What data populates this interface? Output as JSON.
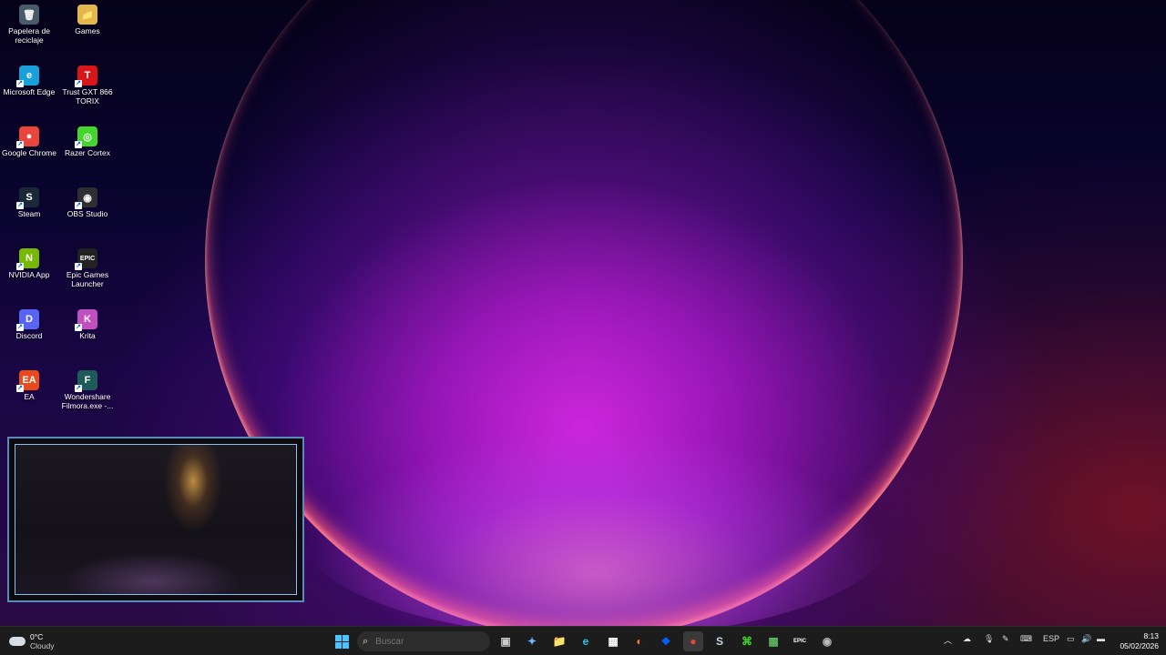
{
  "desktop": {
    "icons": [
      {
        "name": "recycle-bin",
        "label": "Papelera de reciclaje",
        "glyph": "🗑",
        "bg": "#4a5a6a"
      },
      {
        "name": "games-folder",
        "label": "Games",
        "glyph": "📁",
        "bg": "#e2b84c"
      },
      {
        "name": "microsoft-edge",
        "label": "Microsoft Edge",
        "glyph": "e",
        "bg": "#1aa0d8"
      },
      {
        "name": "trust-gxt-866",
        "label": "Trust GXT 866 TORIX",
        "glyph": "T",
        "bg": "#d8161a"
      },
      {
        "name": "google-chrome",
        "label": "Google Chrome",
        "glyph": "●",
        "bg": "#e8453c"
      },
      {
        "name": "razer-cortex",
        "label": "Razer Cortex",
        "glyph": "◎",
        "bg": "#44d62c"
      },
      {
        "name": "steam",
        "label": "Steam",
        "glyph": "S",
        "bg": "#1b2838"
      },
      {
        "name": "obs-studio",
        "label": "OBS Studio",
        "glyph": "◉",
        "bg": "#302e31"
      },
      {
        "name": "nvidia-app",
        "label": "NVIDIA App",
        "glyph": "N",
        "bg": "#76b900"
      },
      {
        "name": "epic-games-launcher",
        "label": "Epic Games Launcher",
        "glyph": "EPIC",
        "bg": "#222222"
      },
      {
        "name": "discord",
        "label": "Discord",
        "glyph": "D",
        "bg": "#5865f2"
      },
      {
        "name": "krita",
        "label": "Krita",
        "glyph": "K",
        "bg": "#c04fc0"
      },
      {
        "name": "ea",
        "label": "EA",
        "glyph": "EA",
        "bg": "#e84a1e"
      },
      {
        "name": "wondershare-filmora",
        "label": "Wondershare Filmora.exe -...",
        "glyph": "F",
        "bg": "#1e5a5a"
      }
    ]
  },
  "taskbar": {
    "weather": {
      "temp": "0°C",
      "condition": "Cloudy"
    },
    "search_placeholder": "Buscar",
    "pinned": [
      {
        "name": "task-view",
        "glyph": "▣",
        "color": "#cccccc"
      },
      {
        "name": "copilot",
        "glyph": "✦",
        "color": "#6fb4ff"
      },
      {
        "name": "file-explorer",
        "glyph": "📁",
        "color": "#e8b84a"
      },
      {
        "name": "edge",
        "glyph": "e",
        "color": "#2ec4f0"
      },
      {
        "name": "microsoft-store",
        "glyph": "▦",
        "color": "#ffffff"
      },
      {
        "name": "firefox",
        "glyph": "◐",
        "color": "#ff7139"
      },
      {
        "name": "dropbox",
        "glyph": "❖",
        "color": "#0061fe"
      },
      {
        "name": "chrome",
        "glyph": "●",
        "color": "#e8453c"
      },
      {
        "name": "steam",
        "glyph": "S",
        "color": "#c7d5e0"
      },
      {
        "name": "razer",
        "glyph": "⌘",
        "color": "#44d62c"
      },
      {
        "name": "minecraft",
        "glyph": "▩",
        "color": "#5cb85c"
      },
      {
        "name": "epic-games",
        "glyph": "EPIC",
        "color": "#ffffff"
      },
      {
        "name": "obs",
        "glyph": "◉",
        "color": "#bbbbbb"
      }
    ],
    "tray": {
      "language": "ESP",
      "time": "8:13",
      "date": "05/02/2026"
    }
  }
}
